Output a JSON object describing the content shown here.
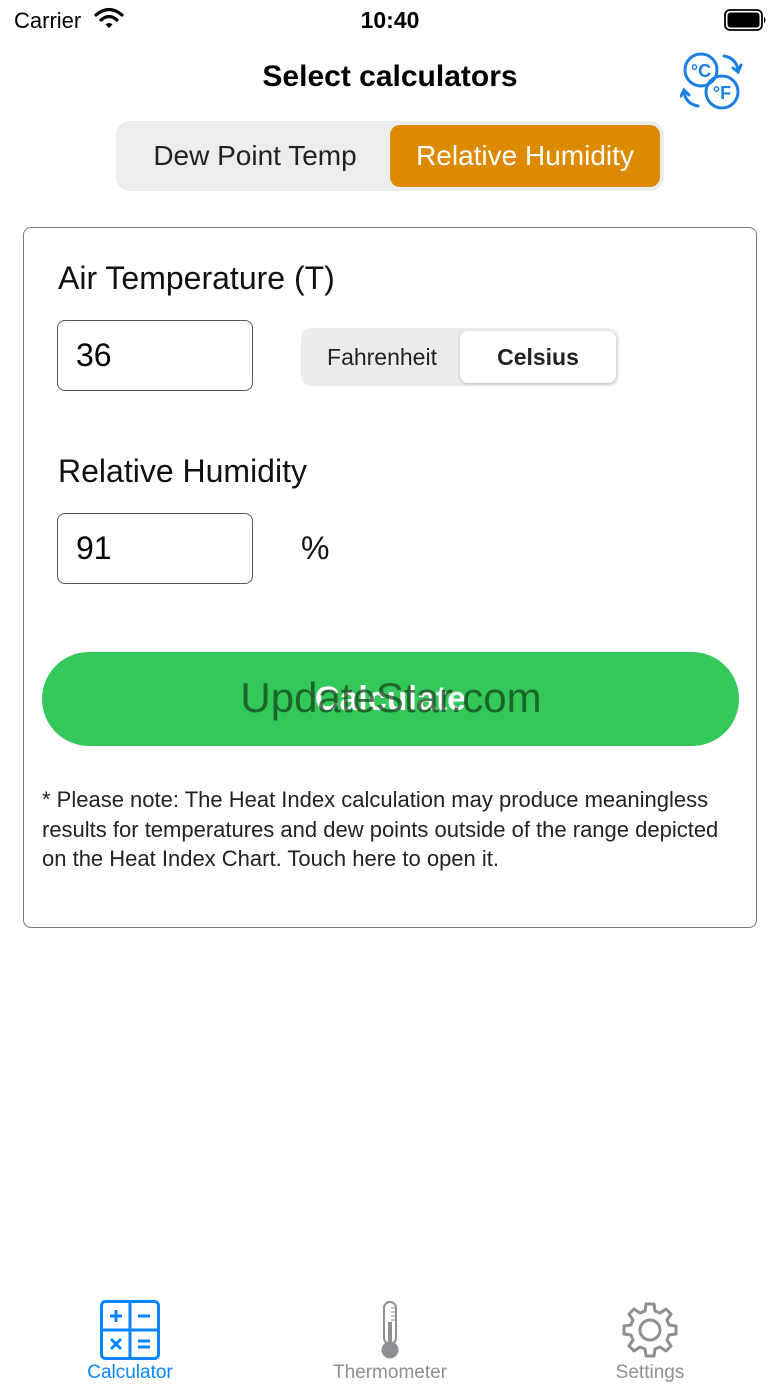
{
  "status_bar": {
    "carrier": "Carrier",
    "time": "10:40"
  },
  "header": {
    "title": "Select calculators",
    "convert_icon": "celsius-fahrenheit-swap-icon"
  },
  "calculator_tabs": {
    "items": [
      {
        "label": "Dew Point Temp",
        "selected": false
      },
      {
        "label": "Relative Humidity",
        "selected": true
      }
    ],
    "accent_color": "#dc8a00"
  },
  "form": {
    "air_temperature_label": "Air Temperature (T)",
    "air_temperature_value": "36",
    "unit_options": [
      {
        "label": "Fahrenheit",
        "selected": false
      },
      {
        "label": "Celsius",
        "selected": true
      }
    ],
    "relative_humidity_label": "Relative Humidity",
    "relative_humidity_value": "91",
    "humidity_unit": "%",
    "calculate_label": "Calculate",
    "calculate_color": "#34c759",
    "watermark": "UpdateStar.com",
    "note": "* Please note: The Heat Index calculation may produce meaningless results for temperatures and dew points outside of the range depicted on the Heat Index Chart. Touch here to open it."
  },
  "tab_bar": {
    "items": [
      {
        "label": "Calculator",
        "icon": "calculator-icon",
        "selected": true
      },
      {
        "label": "Thermometer",
        "icon": "thermometer-icon",
        "selected": false
      },
      {
        "label": "Settings",
        "icon": "gear-icon",
        "selected": false
      }
    ],
    "active_color": "#0a84ff",
    "inactive_color": "#8e8e93"
  }
}
